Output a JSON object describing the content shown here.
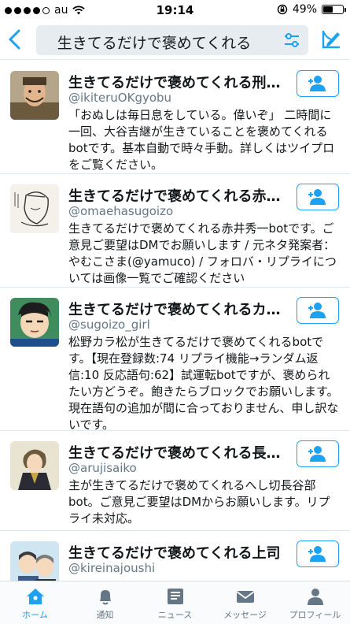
{
  "status_bar": {
    "carrier": "au",
    "time": "19:14",
    "battery_percent_label": "49%",
    "battery_level": 0.49
  },
  "nav": {
    "search_query": "生きてるだけで褒めてくれる"
  },
  "colors": {
    "accent": "#1da1f2",
    "text_primary": "#14171a",
    "text_secondary": "#657786",
    "divider": "#e1e8ed"
  },
  "users": [
    {
      "name": "生きてるだけで褒めてくれる刑部bot",
      "handle": "@ikiteruOKgyobu",
      "bio": "「おぬしは毎日息をしている。偉いぞ」 二時間に一回、大谷吉継が生きていることを褒めてくれるbotです。基本自動で時々手動。詳しくはツイプロをご覧ください。"
    },
    {
      "name": "生きてるだけで褒めてくれる赤井秀…",
      "handle": "@omaehasugoizo",
      "bio": "生きてるだけで褒めてくれる赤井秀一botです。ご意見ご要望はDMでお願いします / 元ネタ発案者：やむこさま(@yamuco) / フォロバ・リプライについては画像一覧でご確認ください"
    },
    {
      "name": "生きてるだけで褒めてくれるカラ松…",
      "handle": "@sugoizo_girl",
      "bio": "松野カラ松が生きてるだけで褒めてくれるbotです。【現在登録数:74 リプライ機能→ランダム返信:10 反応語句:62】試運転botですが、褒められたい方どうぞ。飽きたらブロックでお願いします。現在語句の追加が間に合っておりません、申し訳ないです。"
    },
    {
      "name": "生きてるだけで褒めてくれる長谷部…",
      "handle": "@arujisaiko",
      "bio": "主が生きてるだけで褒めてくれるへし切長谷部bot。ご意見ご要望はDMからお願いします。リプライ未対応。"
    },
    {
      "name": "生きてるだけで褒めてくれる上司",
      "handle": "@kireinajoushi",
      "bio": ""
    }
  ],
  "tabs": [
    {
      "label": "ホーム",
      "icon": "home-icon",
      "active": true
    },
    {
      "label": "通知",
      "icon": "bell-icon",
      "active": false
    },
    {
      "label": "ニュース",
      "icon": "news-icon",
      "active": false
    },
    {
      "label": "メッセージ",
      "icon": "envelope-icon",
      "active": false
    },
    {
      "label": "プロフィール",
      "icon": "person-icon",
      "active": false
    }
  ]
}
